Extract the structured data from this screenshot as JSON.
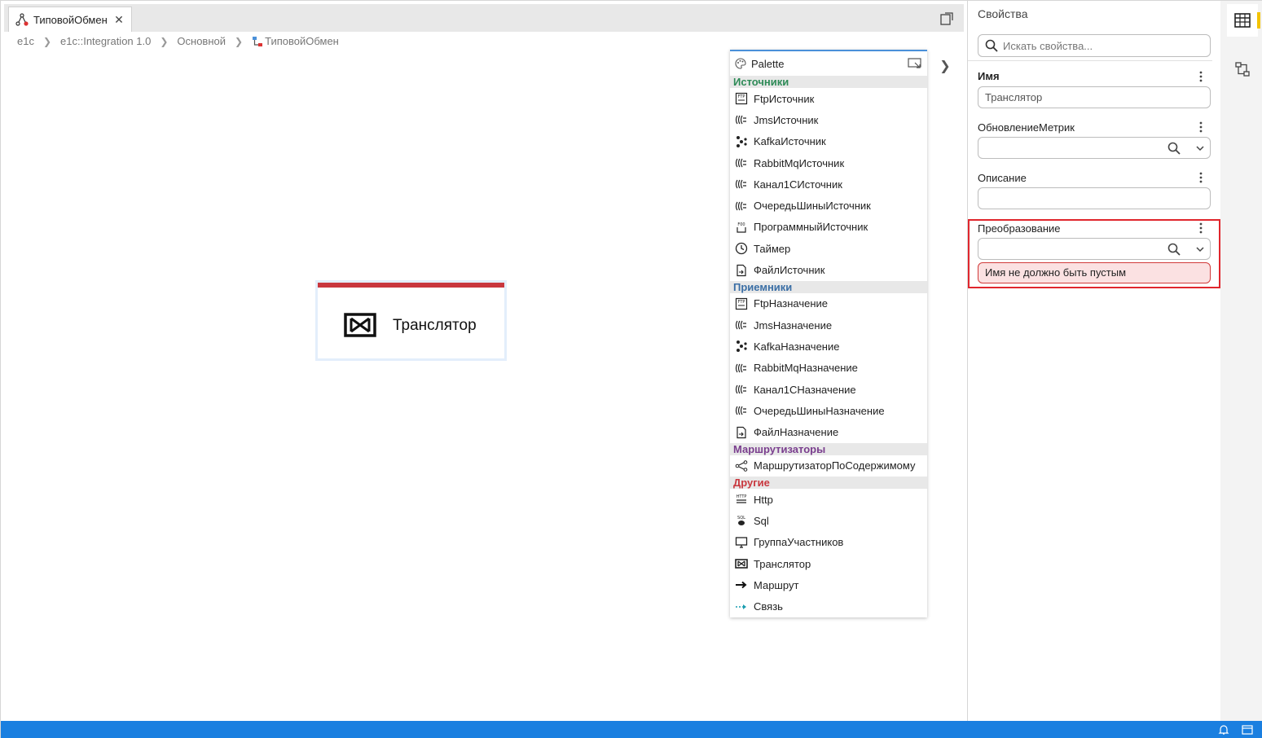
{
  "tab": {
    "label": "ТиповойОбмен",
    "close": "✕"
  },
  "breadcrumb": [
    "e1c",
    "e1c::Integration 1.0",
    "Основной",
    "ТиповойОбмен"
  ],
  "node": {
    "label": "Транслятор",
    "accent": "#c9373e"
  },
  "palette": {
    "title": "Palette",
    "groups": [
      {
        "label": "Источники",
        "color": "#2e8b57",
        "items": [
          "FtpИсточник",
          "JmsИсточник",
          "KafkaИсточник",
          "RabbitMqИсточник",
          "Канал1СИсточник",
          "ОчередьШиныИсточник",
          "ПрограммныйИсточник",
          "Таймер",
          "ФайлИсточник"
        ]
      },
      {
        "label": "Приемники",
        "color": "#3a6ea5",
        "items": [
          "FtpНазначение",
          "JmsНазначение",
          "KafkaНазначение",
          "RabbitMqНазначение",
          "Канал1СНазначение",
          "ОчередьШиныНазначение",
          "ФайлНазначение"
        ]
      },
      {
        "label": "Маршрутизаторы",
        "color": "#7a3e8e",
        "items": [
          "МаршрутизаторПоСодержимому"
        ]
      },
      {
        "label": "Другие",
        "color": "#c9373e",
        "items": [
          "Http",
          "Sql",
          "ГруппаУчастников",
          "Транслятор",
          "Маршрут",
          "Связь"
        ]
      }
    ]
  },
  "properties": {
    "title": "Свойства",
    "search_placeholder": "Искать свойства...",
    "name_label": "Имя",
    "name_value": "Транслятор",
    "metrics_label": "ОбновлениеМетрик",
    "description_label": "Описание",
    "transform_label": "Преобразование",
    "error_text": "Имя не должно быть пустым"
  },
  "colors": {
    "statusbar": "#1a7fe0",
    "error_border": "#e0262d",
    "error_bg": "#fbe1e2"
  }
}
